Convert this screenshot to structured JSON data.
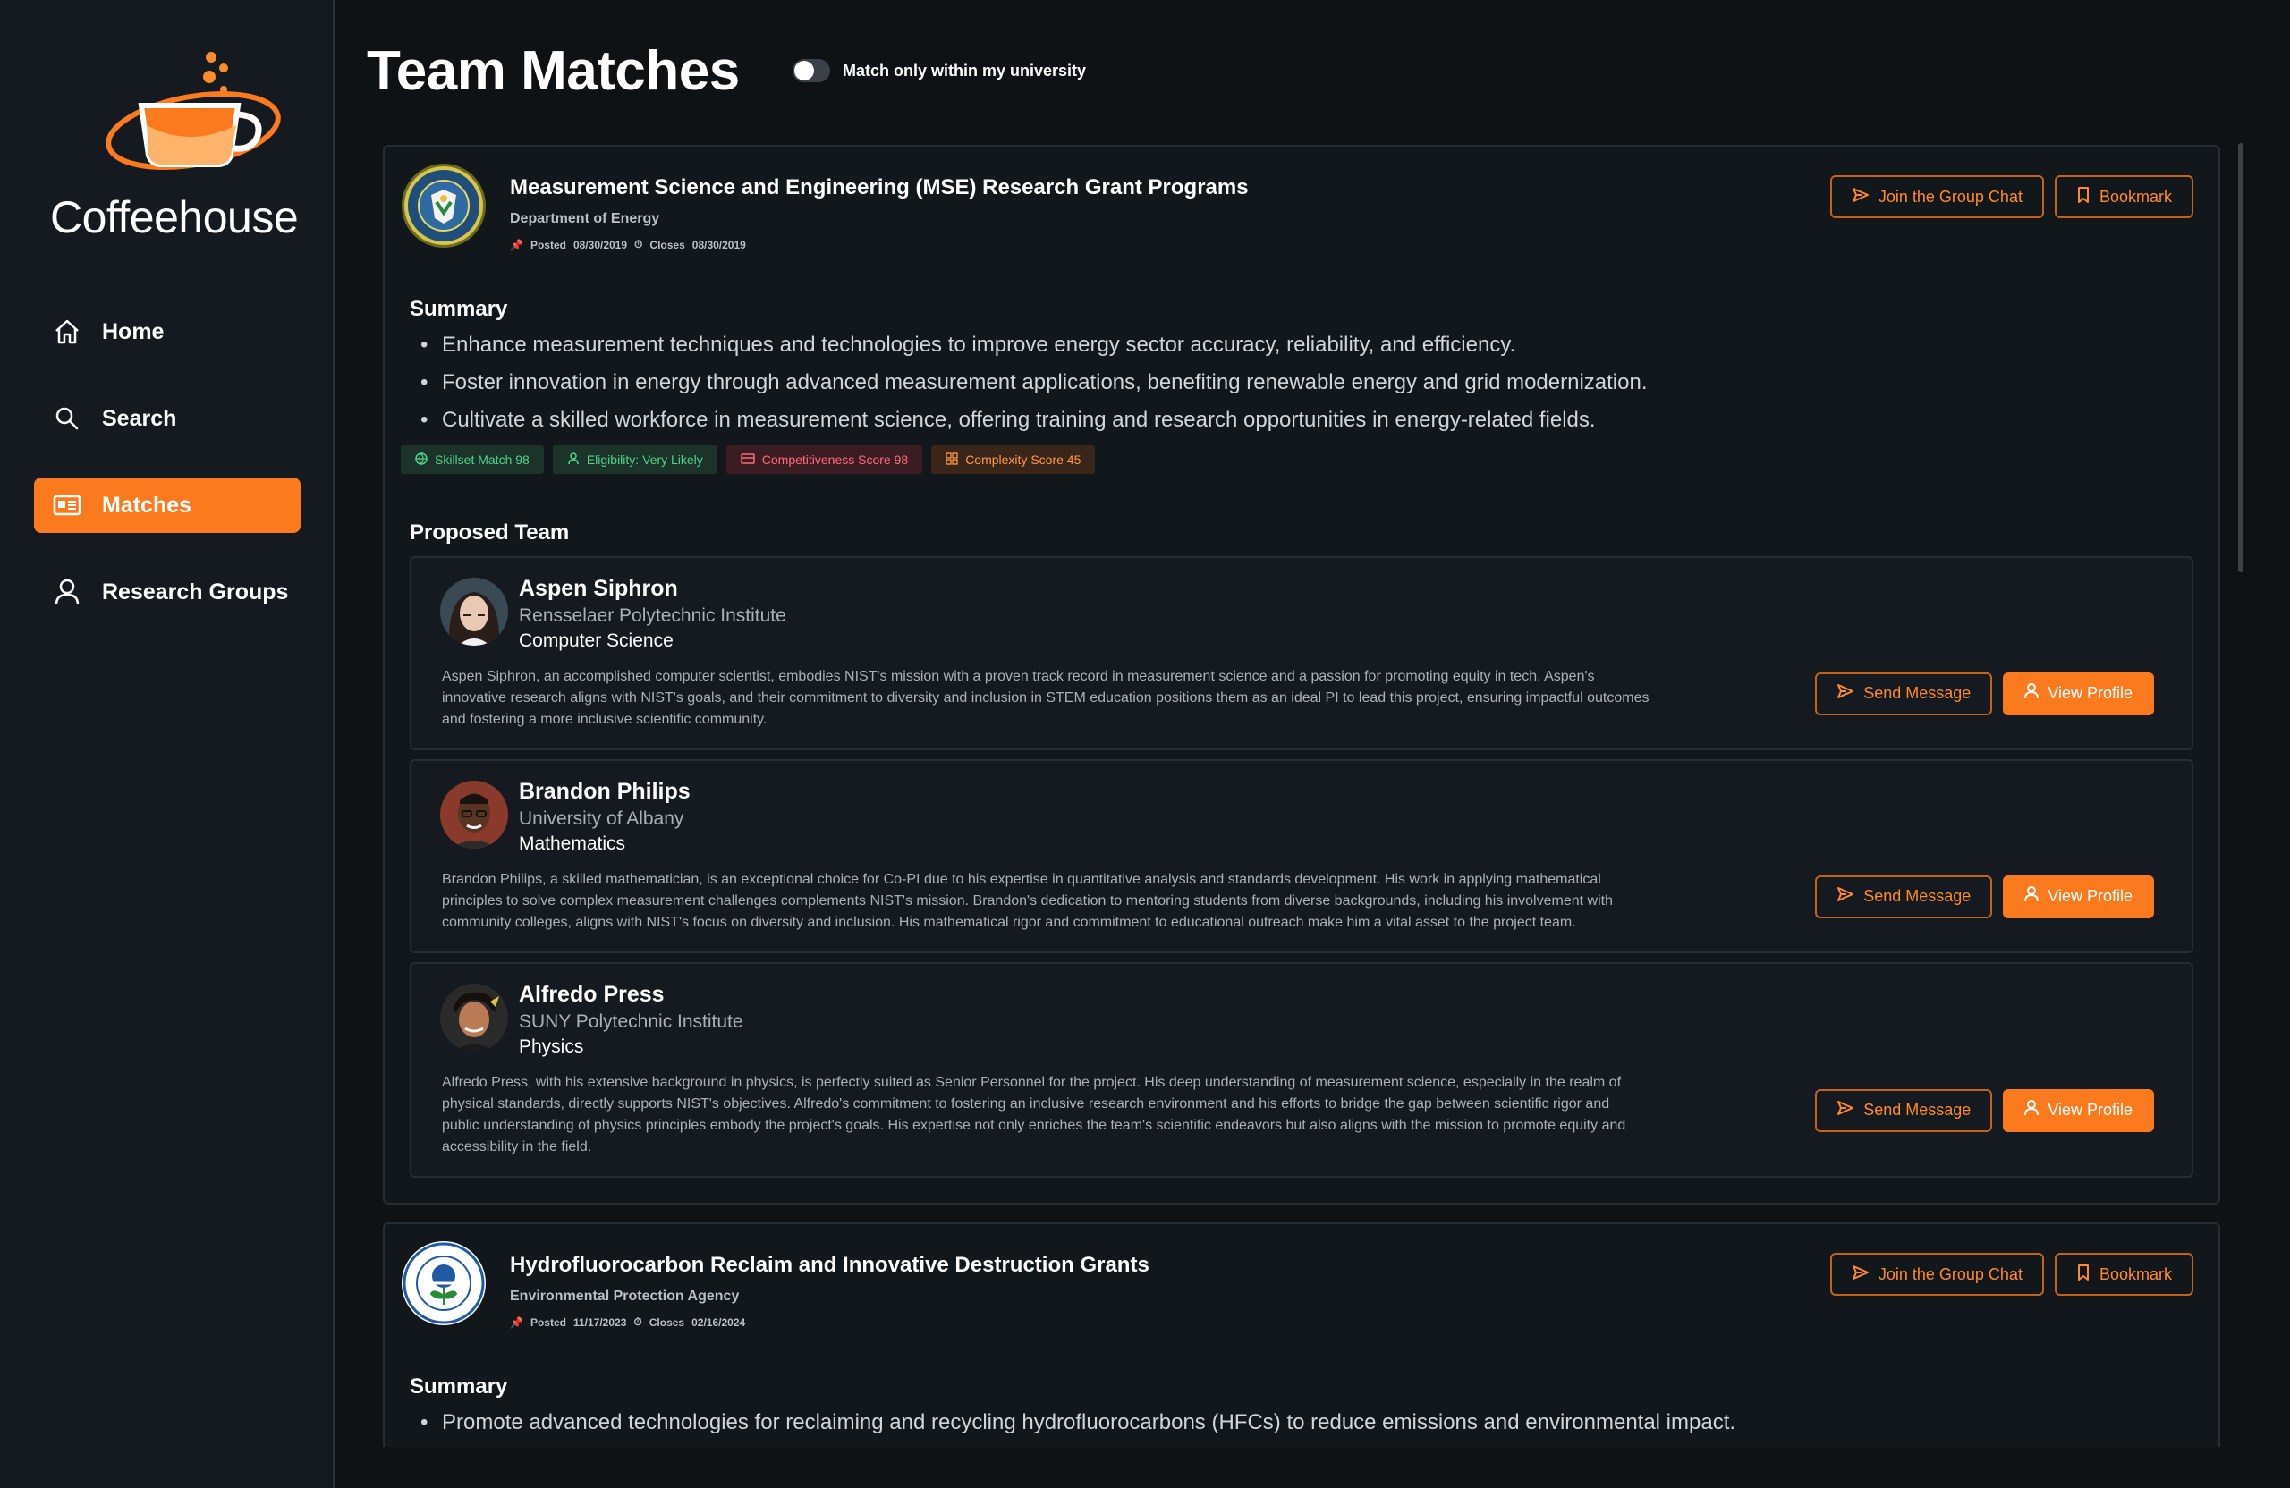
{
  "app": {
    "name": "Coffeehouse"
  },
  "nav": [
    {
      "label": "Home",
      "icon": "home-icon",
      "active": false
    },
    {
      "label": "Search",
      "icon": "search-icon",
      "active": false
    },
    {
      "label": "Matches",
      "icon": "matches-icon",
      "active": true
    },
    {
      "label": "Research Groups",
      "icon": "user-icon",
      "active": false
    }
  ],
  "header": {
    "title": "Team Matches",
    "toggle_label": "Match only within my university",
    "toggle_on": false
  },
  "buttons": {
    "join_chat": "Join the Group Chat",
    "bookmark": "Bookmark",
    "send_message": "Send Message",
    "view_profile": "View Profile"
  },
  "labels": {
    "posted": "Posted",
    "closes": "Closes",
    "summary": "Summary",
    "proposed_team": "Proposed Team"
  },
  "colors": {
    "accent": "#fb7a1e",
    "background": "#0f1215",
    "sidebar": "#141a1f"
  },
  "grants": [
    {
      "title": "Measurement Science and Engineering (MSE) Research Grant Programs",
      "agency": "Department of Energy",
      "posted": "08/30/2019",
      "closes": "08/30/2019",
      "summary": [
        "Enhance measurement techniques and technologies to improve energy sector accuracy, reliability, and efficiency.",
        "Foster innovation in energy through advanced measurement applications, benefiting renewable energy and grid modernization.",
        "Cultivate a skilled workforce in measurement science, offering training and research opportunities in energy-related fields."
      ],
      "badges": [
        {
          "label": "Skillset Match 98",
          "tone": "green"
        },
        {
          "label": "Eligibility: Very Likely",
          "tone": "green"
        },
        {
          "label": "Competitiveness Score 98",
          "tone": "red"
        },
        {
          "label": "Complexity Score 45",
          "tone": "orange"
        }
      ],
      "team": [
        {
          "name": "Aspen Siphron",
          "institution": "Rensselaer Polytechnic Institute",
          "department": "Computer Science",
          "bio": "Aspen Siphron, an accomplished computer scientist, embodies NIST's mission with a proven track record in measurement science and a passion for promoting equity in tech. Aspen's innovative research aligns with NIST's goals, and their commitment to diversity and inclusion in STEM education positions them as an ideal PI to lead this project, ensuring impactful outcomes and fostering a more inclusive scientific community."
        },
        {
          "name": "Brandon Philips",
          "institution": "University of Albany",
          "department": "Mathematics",
          "bio": "Brandon Philips, a skilled mathematician, is an exceptional choice for Co-PI due to his expertise in quantitative analysis and standards development. His work in applying mathematical principles to solve complex measurement challenges complements NIST's mission. Brandon's dedication to mentoring students from diverse backgrounds, including his involvement with community colleges, aligns with NIST's focus on diversity and inclusion. His mathematical rigor and commitment to educational outreach make him a vital asset to the project team."
        },
        {
          "name": "Alfredo Press",
          "institution": "SUNY Polytechnic Institute",
          "department": "Physics",
          "bio": "Alfredo Press, with his extensive background in physics, is perfectly suited as Senior Personnel for the project. His deep understanding of measurement science, especially in the realm of physical standards, directly supports NIST's objectives. Alfredo's commitment to fostering an inclusive research environment and his efforts to bridge the gap between scientific rigor and public understanding of physics principles embody the project's goals. His expertise not only enriches the team's scientific endeavors but also aligns with the mission to promote equity and accessibility in the field."
        }
      ]
    },
    {
      "title": "Hydrofluorocarbon Reclaim and Innovative Destruction Grants",
      "agency": "Environmental Protection Agency",
      "posted": "11/17/2023",
      "closes": "02/16/2024",
      "summary": [
        "Promote advanced technologies for reclaiming and recycling hydrofluorocarbons (HFCs) to reduce emissions and environmental impact."
      ]
    }
  ]
}
